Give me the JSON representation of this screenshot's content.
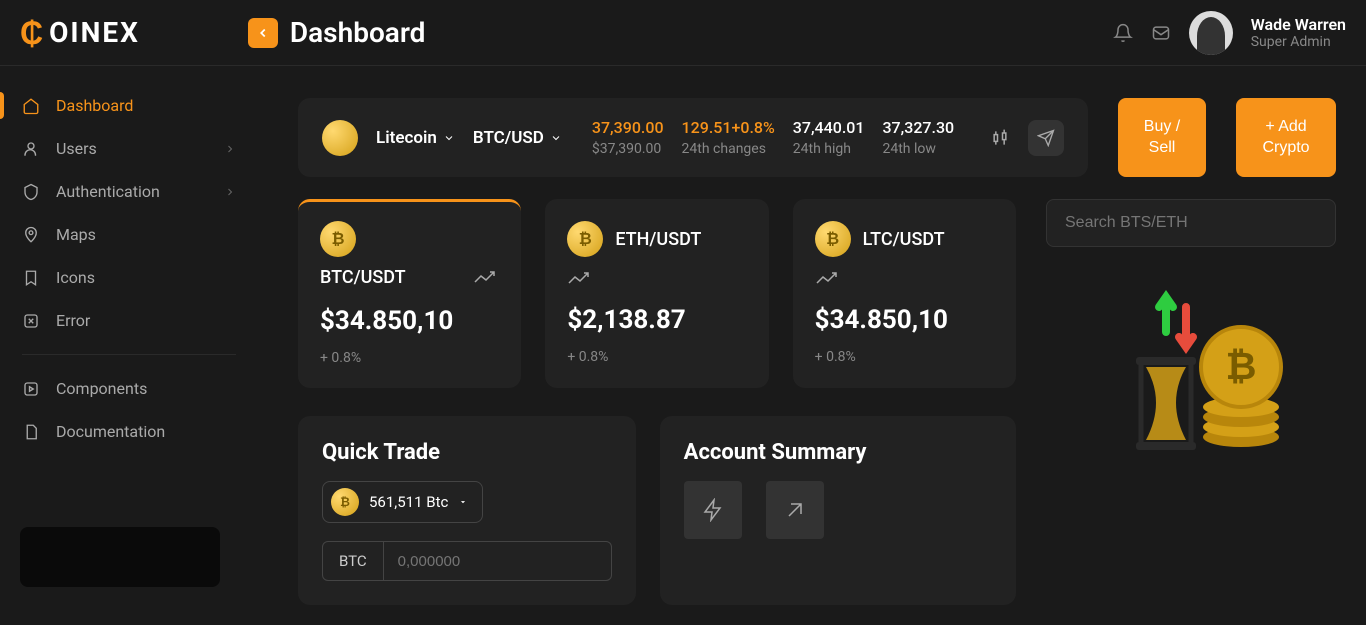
{
  "brand": "OINEX",
  "page_title": "Dashboard",
  "user": {
    "name": "Wade Warren",
    "role": "Super Admin"
  },
  "sidebar": {
    "items": [
      {
        "label": "Dashboard"
      },
      {
        "label": "Users"
      },
      {
        "label": "Authentication"
      },
      {
        "label": "Maps"
      },
      {
        "label": "Icons"
      },
      {
        "label": "Error"
      }
    ],
    "extra": [
      {
        "label": "Components"
      },
      {
        "label": "Documentation"
      }
    ]
  },
  "ticker": {
    "coin": "Litecoin",
    "pair": "BTC/USD",
    "price": "37,390.00",
    "price_sub": "$37,390.00",
    "change": "129.51+0.8%",
    "change_label": "24th changes",
    "high": "37,440.01",
    "high_label": "24th high",
    "low": "37,327.30",
    "low_label": "24th low"
  },
  "buttons": {
    "buy_sell": "Buy / Sell",
    "add_crypto": "+ Add Crypto"
  },
  "cards": [
    {
      "pair": "BTC/USDT",
      "price": "$34.850,10",
      "change": "+ 0.8%"
    },
    {
      "pair": "ETH/USDT",
      "price": "$2,138.87",
      "change": "+ 0.8%"
    },
    {
      "pair": "LTC/USDT",
      "price": "$34.850,10",
      "change": "+ 0.8%"
    }
  ],
  "search": {
    "placeholder": "Search BTS/ETH"
  },
  "quick_trade": {
    "title": "Quick Trade",
    "amount": "561,511 Btc",
    "input_label": "BTC",
    "input_placeholder": "0,000000"
  },
  "account_summary": {
    "title": "Account Summary"
  }
}
